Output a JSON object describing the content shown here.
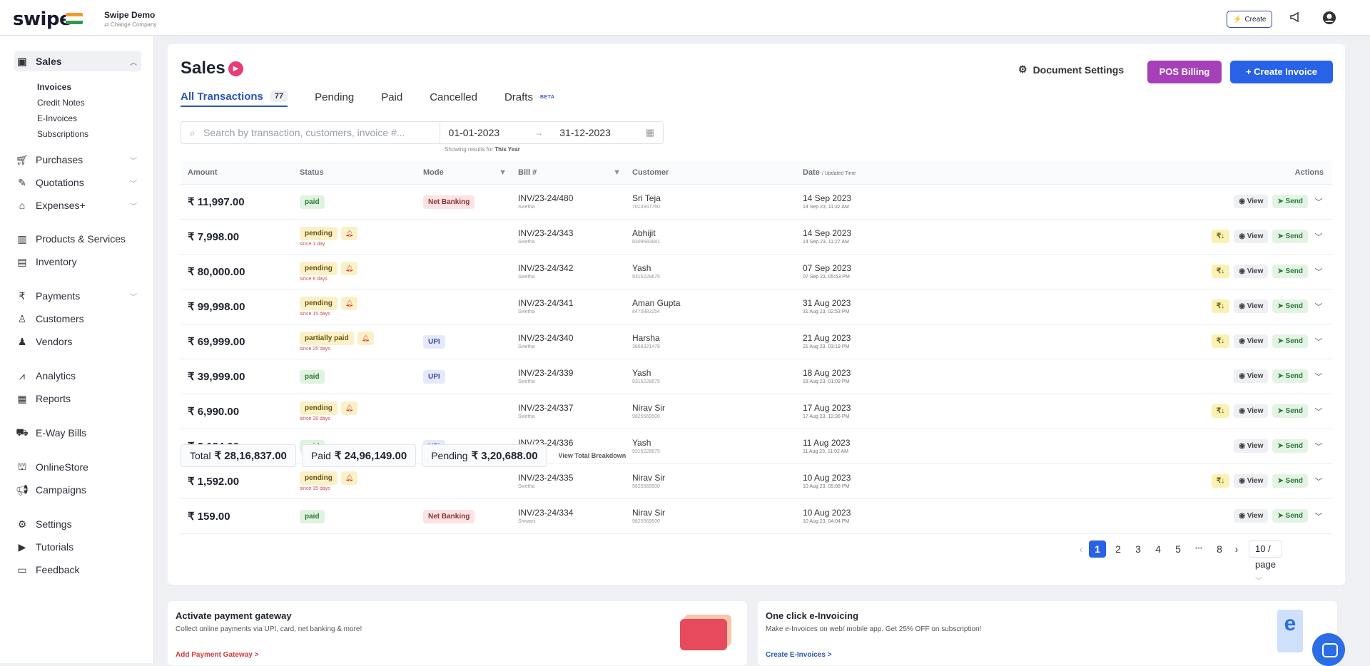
{
  "app": {
    "logo": "swipe",
    "company_name": "Swipe Demo",
    "company_sub": "⇄ Change Company"
  },
  "topbar": {
    "create_label": "Create"
  },
  "sidebar": {
    "sales": "Sales",
    "sales_sub": [
      "Invoices",
      "Credit Notes",
      "E-Invoices",
      "Subscriptions"
    ],
    "items": [
      "Purchases",
      "Quotations",
      "Expenses+",
      "Products & Services",
      "Inventory",
      "Payments",
      "Customers",
      "Vendors",
      "Analytics",
      "Reports",
      "E-Way Bills",
      "OnlineStore",
      "Campaigns",
      "Settings",
      "Tutorials",
      "Feedback"
    ]
  },
  "page": {
    "title": "Sales",
    "doc_settings": "Document Settings",
    "pos_billing": "POS Billing",
    "create_invoice": "+ Create Invoice",
    "tabs": [
      {
        "label": "All Transactions",
        "count": "77"
      },
      {
        "label": "Pending"
      },
      {
        "label": "Paid"
      },
      {
        "label": "Cancelled"
      },
      {
        "label": "Drafts",
        "badge": "BETA"
      }
    ]
  },
  "filter": {
    "search_placeholder": "Search by transaction, customers, invoice #...",
    "date_from": "01-01-2023",
    "date_to": "31-12-2023",
    "showing_prefix": "Showing results for",
    "showing_value": "This Year"
  },
  "table": {
    "headers": [
      "Amount",
      "Status",
      "Mode",
      "Bill #",
      "Customer",
      "Date",
      "Actions"
    ],
    "date_header_sub": "/ Updated Time",
    "rows": [
      {
        "amount": "₹ 11,997.00",
        "status": "paid",
        "since": "",
        "mode": "Net Banking",
        "bill": "INV/23-24/480",
        "bill_sub": "Swetha",
        "customer": "Sri Teja",
        "phone": "7013347760",
        "date": "14 Sep 2023",
        "date_sub": "14 Sep 23, 11:32 AM",
        "rs": false
      },
      {
        "amount": "₹ 7,998.00",
        "status": "pending",
        "since": "since 1 day",
        "mode": "",
        "bill": "INV/23-24/343",
        "bill_sub": "Swetha",
        "customer": "Abhijit",
        "phone": "8309683881",
        "date": "14 Sep 2023",
        "date_sub": "14 Sep 23, 11:27 AM",
        "rs": true
      },
      {
        "amount": "₹ 80,000.00",
        "status": "pending",
        "since": "since 8 days",
        "mode": "",
        "bill": "INV/23-24/342",
        "bill_sub": "Swetha",
        "customer": "Yash",
        "phone": "9315228675",
        "date": "07 Sep 2023",
        "date_sub": "07 Sep 23, 05:53 PM",
        "rs": true
      },
      {
        "amount": "₹ 99,998.00",
        "status": "pending",
        "since": "since 15 days",
        "mode": "",
        "bill": "INV/23-24/341",
        "bill_sub": "Swetha",
        "customer": "Aman Gupta",
        "phone": "8470883254",
        "date": "31 Aug 2023",
        "date_sub": "31 Aug 23, 02:53 PM",
        "rs": true
      },
      {
        "amount": "₹ 69,999.00",
        "status": "partially paid",
        "since": "since 25 days",
        "mode": "UPI",
        "bill": "INV/23-24/340",
        "bill_sub": "Swetha",
        "customer": "Harsha",
        "phone": "3868321478",
        "date": "21 Aug 2023",
        "date_sub": "21 Aug 23, 03:19 PM",
        "rs": true
      },
      {
        "amount": "₹ 39,999.00",
        "status": "paid",
        "since": "",
        "mode": "UPI",
        "bill": "INV/23-24/339",
        "bill_sub": "Swetha",
        "customer": "Yash",
        "phone": "9315228675",
        "date": "18 Aug 2023",
        "date_sub": "18 Aug 23, 01:09 PM",
        "rs": false
      },
      {
        "amount": "₹ 6,990.00",
        "status": "pending",
        "since": "since 28 days",
        "mode": "",
        "bill": "INV/23-24/337",
        "bill_sub": "Swetha",
        "customer": "Nirav Sir",
        "phone": "9825569500",
        "date": "17 Aug 2023",
        "date_sub": "17 Aug 23, 12:36 PM",
        "rs": true
      },
      {
        "amount": "₹ 3,184.00",
        "status": "paid",
        "since": "",
        "mode": "UPI",
        "bill": "INV/23-24/336",
        "bill_sub": "Swetha",
        "customer": "Yash",
        "phone": "9315228675",
        "date": "11 Aug 2023",
        "date_sub": "11 Aug 23, 11:02 AM",
        "rs": false
      },
      {
        "amount": "₹ 1,592.00",
        "status": "pending",
        "since": "since 35 days",
        "mode": "",
        "bill": "INV/23-24/335",
        "bill_sub": "Swetha",
        "customer": "Nirav Sir",
        "phone": "9825569500",
        "date": "10 Aug 2023",
        "date_sub": "10 Aug 23, 05:08 PM",
        "rs": true
      },
      {
        "amount": "₹ 159.00",
        "status": "paid",
        "since": "",
        "mode": "Net Banking",
        "bill": "INV/23-24/334",
        "bill_sub": "Shiwani",
        "customer": "Nirav Sir",
        "phone": "9825569500",
        "date": "10 Aug 2023",
        "date_sub": "10 Aug 23, 04:04 PM",
        "rs": false
      }
    ],
    "view_label": "View",
    "send_label": "Send",
    "rs_label": "₹↓"
  },
  "totals": {
    "total_label": "Total",
    "total": "₹ 28,16,837.00",
    "paid_label": "Paid",
    "paid": "₹ 24,96,149.00",
    "pending_label": "Pending",
    "pending": "₹ 3,20,688.00",
    "breakdown": "View Total Breakdown"
  },
  "pagination": {
    "pages": [
      "1",
      "2",
      "3",
      "4",
      "5",
      "•••",
      "8"
    ],
    "current": "1",
    "per_page": "10 / page"
  },
  "cards": [
    {
      "title": "Activate payment gateway",
      "sub": "Collect online payments via UPI, card, net banking & more!",
      "link": "Add Payment Gateway >"
    },
    {
      "title": "One click e-Invoicing",
      "sub": "Make e-Invoices on web/ mobile app. Get 25% OFF on subscription!",
      "link": "Create E-Invoices >"
    }
  ],
  "colors": {
    "primary": "#2762e7",
    "pos": "#a640b8",
    "link_red": "#d23b3b",
    "link_blue": "#2b56b7"
  }
}
